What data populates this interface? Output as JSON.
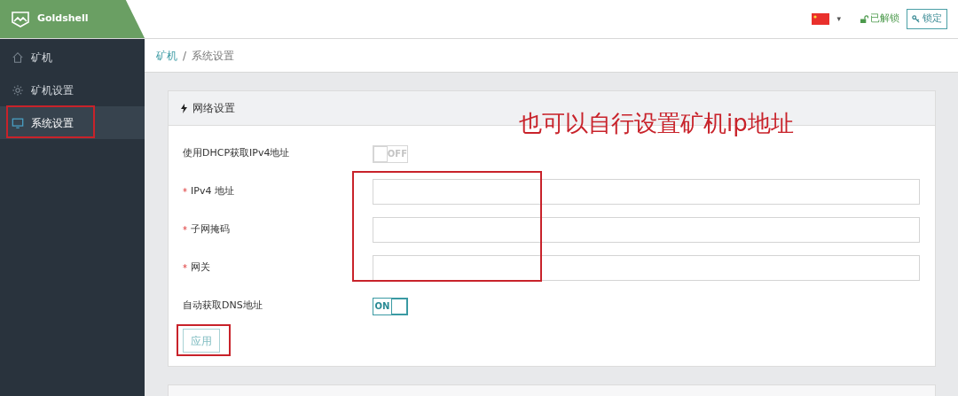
{
  "header": {
    "brand": "Goldshell",
    "language_caret": "▾",
    "unlock_status": "已解锁",
    "lock_button": "锁定"
  },
  "sidebar": {
    "items": [
      {
        "label": "矿机",
        "kind": "home",
        "selected": false
      },
      {
        "label": "矿机设置",
        "kind": "gear",
        "selected": false
      },
      {
        "label": "系统设置",
        "kind": "monitor",
        "selected": true
      }
    ]
  },
  "breadcrumb": [
    {
      "label": "矿机",
      "link": true
    },
    {
      "label": "/",
      "link": false
    },
    {
      "label": "系统设置",
      "link": false
    }
  ],
  "card": {
    "title": "网络设置",
    "rows": [
      {
        "kind": "toggle",
        "label": "使用DHCP获取IPv4地址",
        "on": false,
        "text": "OFF"
      },
      {
        "kind": "input",
        "marker": "*",
        "label": "IPv4 地址"
      },
      {
        "kind": "input",
        "marker": "*",
        "label": "子网掩码"
      },
      {
        "kind": "input",
        "marker": "*",
        "label": "网关"
      },
      {
        "kind": "toggle",
        "label": "自动获取DNS地址",
        "on": true,
        "text": "ON"
      }
    ],
    "button": "应用"
  },
  "annotation": "也可以自行设置矿机ip地址"
}
